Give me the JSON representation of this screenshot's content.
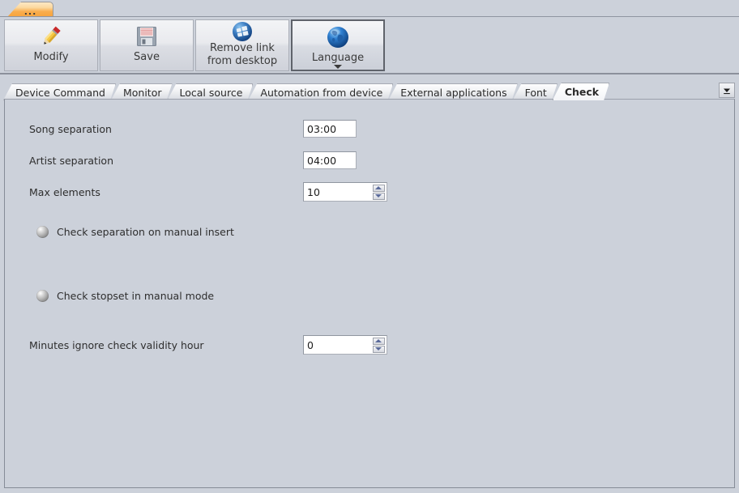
{
  "window": {
    "doc_tab_label": "...",
    "accent_orange": "#f7a33c",
    "panel_bg": "#ccd1da"
  },
  "toolbar": {
    "buttons": [
      {
        "label": "Modify",
        "icon": "pencil-icon",
        "active": false,
        "has_caret": false
      },
      {
        "label": "Save",
        "icon": "floppy-disk-icon",
        "active": false,
        "has_caret": false
      },
      {
        "label_line1": "Remove link",
        "label_line2": "from desktop",
        "icon": "windows-logo-icon",
        "active": false,
        "has_caret": false
      },
      {
        "label": "Language",
        "icon": "globe-icon",
        "active": true,
        "has_caret": true
      }
    ]
  },
  "tabs": {
    "items": [
      {
        "label": "Device Command",
        "selected": false
      },
      {
        "label": "Monitor",
        "selected": false
      },
      {
        "label": "Local source",
        "selected": false
      },
      {
        "label": "Automation from device",
        "selected": false
      },
      {
        "label": "External applications",
        "selected": false
      },
      {
        "label": "Font",
        "selected": false
      },
      {
        "label": "Check",
        "selected": true
      }
    ],
    "overflow_icon": "chevron-down-icon"
  },
  "form": {
    "song_separation": {
      "label": "Song separation",
      "value": "03:00"
    },
    "artist_separation": {
      "label": "Artist separation",
      "value": "04:00"
    },
    "max_elements": {
      "label": "Max elements",
      "value": "10"
    },
    "check_separation_manual_insert": {
      "label": "Check separation on manual insert",
      "state": "off"
    },
    "check_stopset_manual_mode": {
      "label": "Check stopset in manual mode",
      "state": "off"
    },
    "minutes_ignore_check_validity_hour": {
      "label": "Minutes ignore check validity hour",
      "value": "0"
    }
  }
}
